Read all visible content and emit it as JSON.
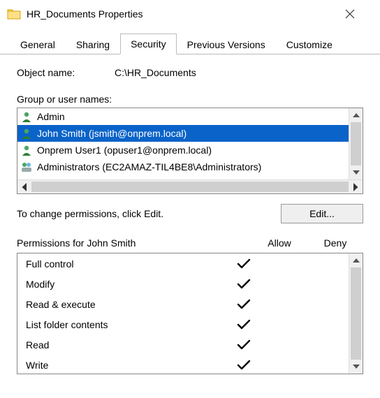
{
  "window": {
    "title": "HR_Documents Properties"
  },
  "tabs": {
    "general": "General",
    "sharing": "Sharing",
    "security": "Security",
    "previous": "Previous Versions",
    "customize": "Customize"
  },
  "object_name_label": "Object name:",
  "object_name_value": "C:\\HR_Documents",
  "group_label": "Group or user names:",
  "users": [
    {
      "name": "Admin",
      "kind": "user"
    },
    {
      "name": "John Smith (jsmith@onprem.local)",
      "kind": "user",
      "selected": true
    },
    {
      "name": "Onprem User1 (opuser1@onprem.local)",
      "kind": "user"
    },
    {
      "name": "Administrators (EC2AMAZ-TIL4BE8\\Administrators)",
      "kind": "group"
    }
  ],
  "edit_hint": "To change permissions, click Edit.",
  "edit_button": "Edit...",
  "perm_header": {
    "title": "Permissions for John Smith",
    "allow": "Allow",
    "deny": "Deny"
  },
  "permissions": [
    {
      "name": "Full control",
      "allow": true,
      "deny": false
    },
    {
      "name": "Modify",
      "allow": true,
      "deny": false
    },
    {
      "name": "Read & execute",
      "allow": true,
      "deny": false
    },
    {
      "name": "List folder contents",
      "allow": true,
      "deny": false
    },
    {
      "name": "Read",
      "allow": true,
      "deny": false
    },
    {
      "name": "Write",
      "allow": true,
      "deny": false
    }
  ]
}
